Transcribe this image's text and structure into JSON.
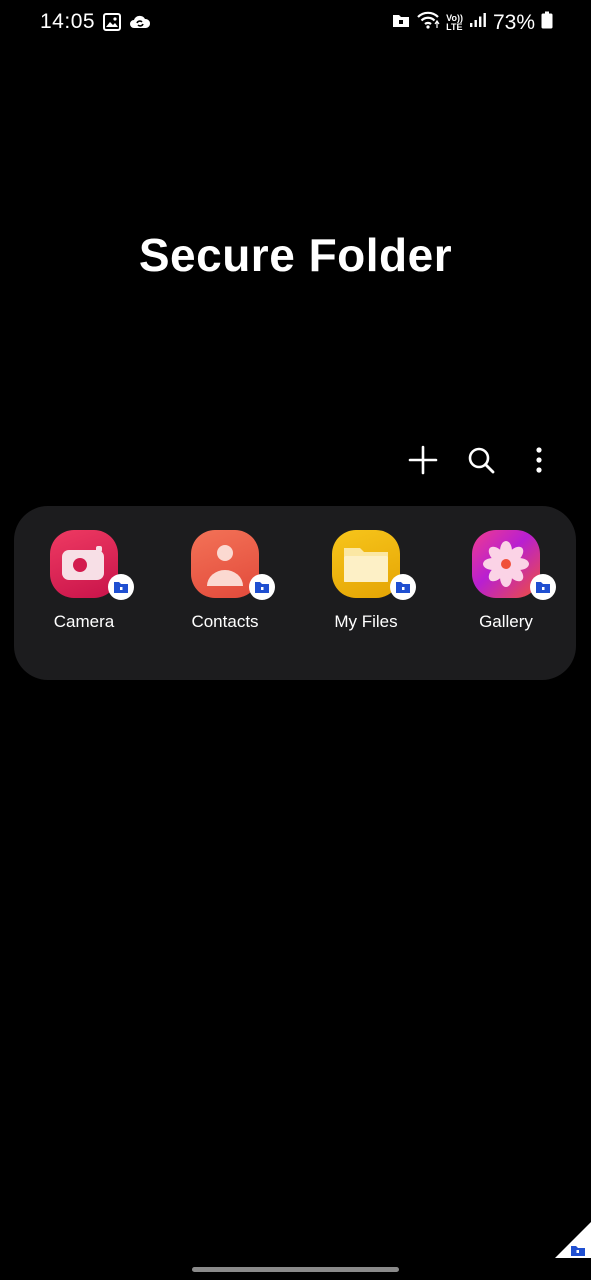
{
  "status_bar": {
    "time": "14:05",
    "battery_percent": "73%",
    "network_label_top": "Vo))",
    "network_label_bottom": "LTE",
    "icons": [
      "gallery-notification-icon",
      "cloud-sync-icon",
      "secure-folder-status-icon",
      "wifi-icon",
      "volte-icon",
      "signal-icon",
      "battery-icon"
    ]
  },
  "title": "Secure Folder",
  "toolbar": {
    "icons": [
      "add-icon",
      "search-icon",
      "more-options-icon"
    ]
  },
  "apps": [
    {
      "label": "Camera",
      "icon": "camera-icon",
      "color": "#d6204f"
    },
    {
      "label": "Contacts",
      "icon": "contacts-icon",
      "color": "#ea5a47"
    },
    {
      "label": "My Files",
      "icon": "my-files-icon",
      "color": "#f2b705"
    },
    {
      "label": "Gallery",
      "icon": "gallery-icon",
      "color": "#d61c8a"
    }
  ],
  "colors": {
    "background": "#000000",
    "panel": "#1c1c1e",
    "badge_blue": "#1f4fd1"
  }
}
